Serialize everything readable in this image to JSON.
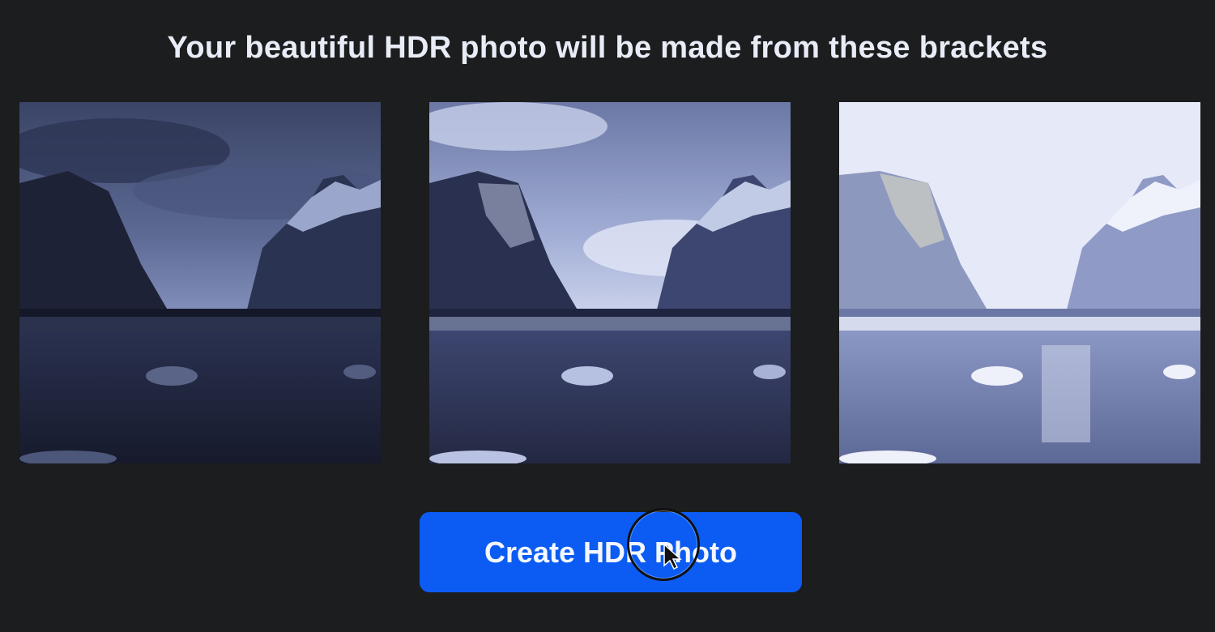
{
  "page": {
    "title": "Your beautiful HDR photo will be made from these brackets"
  },
  "brackets": [
    {
      "exposure": "dark"
    },
    {
      "exposure": "normal"
    },
    {
      "exposure": "bright"
    }
  ],
  "actions": {
    "create_label": "Create HDR Photo"
  },
  "colors": {
    "background": "#1b1d1e",
    "button": "#0c5cf3",
    "title_text": "#e8ecf6"
  }
}
